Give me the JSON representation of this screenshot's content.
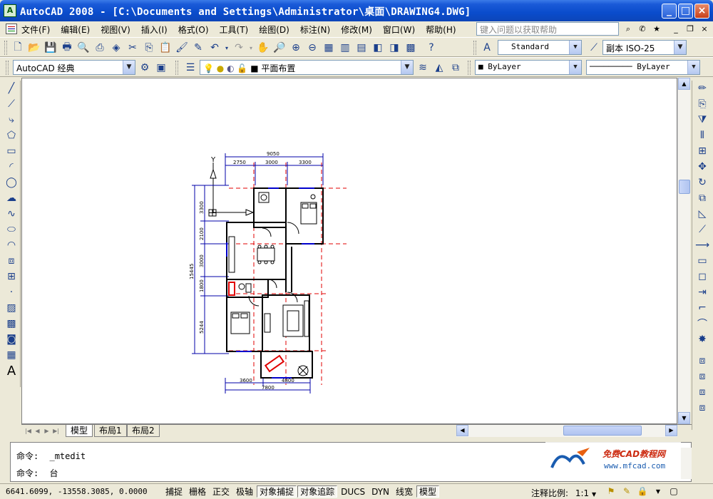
{
  "window": {
    "title": "AutoCAD 2008 - [C:\\Documents and Settings\\Administrator\\桌面\\DRAWING4.DWG]",
    "app_icon": "autocad-icon"
  },
  "menu": {
    "items": [
      "文件(F)",
      "编辑(E)",
      "视图(V)",
      "插入(I)",
      "格式(O)",
      "工具(T)",
      "绘图(D)",
      "标注(N)",
      "修改(M)",
      "窗口(W)",
      "帮助(H)"
    ],
    "help_placeholder": "键入问题以获取帮助"
  },
  "toolbars": {
    "text_style": "Standard",
    "dim_style": "副本 ISO-25",
    "workspace": "AutoCAD 经典",
    "layer": "平面布置",
    "color": "ByLayer",
    "linetype": "ByLayer"
  },
  "drawing": {
    "ucs_y_label": "Y",
    "top_dims": [
      "9050",
      "2750",
      "3000",
      "3300"
    ],
    "left_dims": [
      "15445",
      "3300",
      "2100",
      "3000",
      "1800",
      "5244"
    ],
    "bottom_dims": [
      "3600",
      "4800",
      "7800"
    ]
  },
  "layout_tabs": [
    "模型",
    "布局1",
    "布局2"
  ],
  "command": {
    "line1_prompt": "命令:",
    "line1_value": "_mtedit",
    "line2_prompt": "命令:",
    "line2_value": "台"
  },
  "watermark": {
    "title": "免费CAD教程网",
    "url": "www.mfcad.com"
  },
  "status": {
    "coords": "6641.6099, -13558.3085, 0.0000",
    "buttons": [
      {
        "label": "捕捉",
        "on": false
      },
      {
        "label": "栅格",
        "on": false
      },
      {
        "label": "正交",
        "on": false
      },
      {
        "label": "极轴",
        "on": false
      },
      {
        "label": "对象捕捉",
        "on": true
      },
      {
        "label": "对象追踪",
        "on": true
      },
      {
        "label": "DUCS",
        "on": false
      },
      {
        "label": "DYN",
        "on": false
      },
      {
        "label": "线宽",
        "on": false
      },
      {
        "label": "模型",
        "on": true
      }
    ],
    "annotation_scale_label": "注释比例:",
    "annotation_scale_value": "1:1"
  }
}
